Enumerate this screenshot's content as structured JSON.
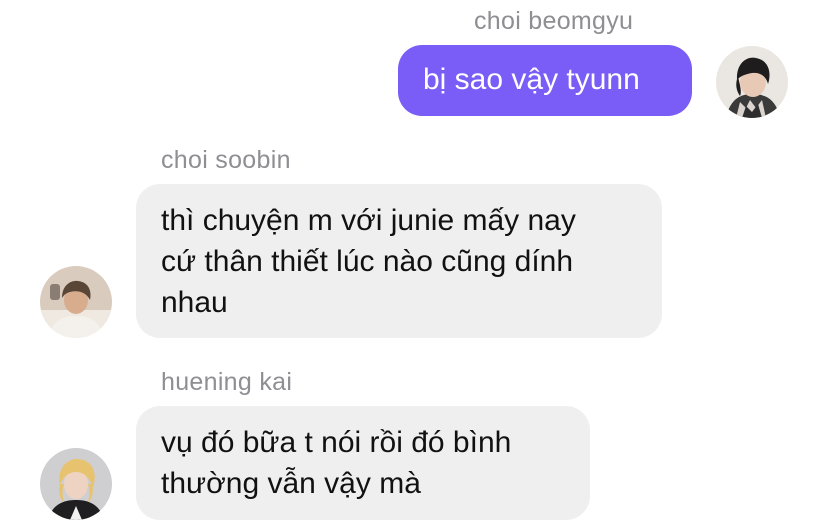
{
  "messages": [
    {
      "sender": "choi beomgyu",
      "direction": "outgoing",
      "lines": [
        "bị sao vậy tyunn"
      ],
      "avatar_icon": "beomgyu-avatar-icon"
    },
    {
      "sender": "choi soobin",
      "direction": "incoming",
      "lines": [
        "thì chuyện m với junie mấy nay",
        "cứ thân thiết lúc nào cũng dính",
        "nhau"
      ],
      "avatar_icon": "soobin-avatar-icon"
    },
    {
      "sender": "huening kai",
      "direction": "incoming",
      "lines": [
        "vụ đó bữa t nói rồi đó bình",
        "thường vẫn vậy mà"
      ],
      "avatar_icon": "hueningkai-avatar-icon"
    }
  ],
  "colors": {
    "outgoing_bubble": "#7a5df6",
    "incoming_bubble": "#efeff0",
    "sender_name": "#8e8e93"
  }
}
